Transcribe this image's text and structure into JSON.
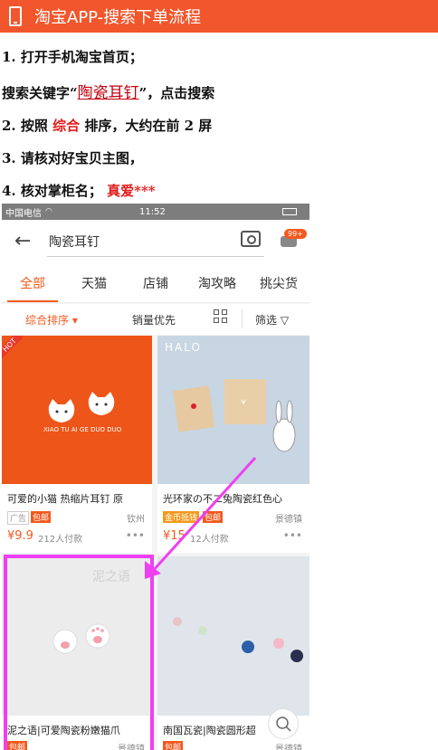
{
  "banner": {
    "title": "淘宝APP-搜索下单流程"
  },
  "steps": {
    "s1": "1. 打开手机淘宝首页；",
    "s2_prefix": "搜索关键字“",
    "s2_keyword": "陶瓷耳钉",
    "s2_suffix": "”，点击搜索",
    "s3_prefix": "2. 按照 ",
    "s3_highlight": "综合",
    "s3_suffix": " 排序，大约在前 2 屏",
    "s4": "3. 请核对好宝贝主图，",
    "s5_prefix": "4. 核对掌柜名；  ",
    "s5_highlight": "真爱***"
  },
  "phone": {
    "status": {
      "carrier": "中国电信",
      "time": "11:52"
    },
    "search": {
      "query": "陶瓷耳钉",
      "badge": "99+"
    },
    "tabs": [
      "全部",
      "天猫",
      "店铺",
      "淘攻略",
      "挑尖货"
    ],
    "sort": {
      "comprehensive": "综合排序 ▾",
      "sales": "销量优先",
      "filter": "筛选"
    },
    "cards": [
      {
        "name": "可爱的小猫 热缩片耳钉 原",
        "tag1": "广告",
        "tag2": "包邮",
        "price": "¥9.9",
        "sold": "212人付款",
        "loc": "钦州",
        "hot": "HOT",
        "img_text": "XIAO TU AI GE DUO DUO"
      },
      {
        "name": "光环家の不二兔陶瓷红色心",
        "tag1": "金币抵钱",
        "tag2": "包邮",
        "price": "¥15",
        "sold": "12人付款",
        "loc": "景德镇",
        "img_text": "HALO"
      },
      {
        "name": "泥之语|可爱陶瓷粉嫩猫爪",
        "tag1": "包邮",
        "loc": "景德镇",
        "img_text": "泥之语"
      },
      {
        "name": "南国瓦瓷|陶瓷圆形超",
        "tag1": "包邮",
        "loc": "景德镇"
      }
    ]
  },
  "colors": {
    "accent": "#f3591e",
    "banner": "#f2562c",
    "highlight": "#ef3ff2",
    "instruction_red": "#e21a1a"
  }
}
